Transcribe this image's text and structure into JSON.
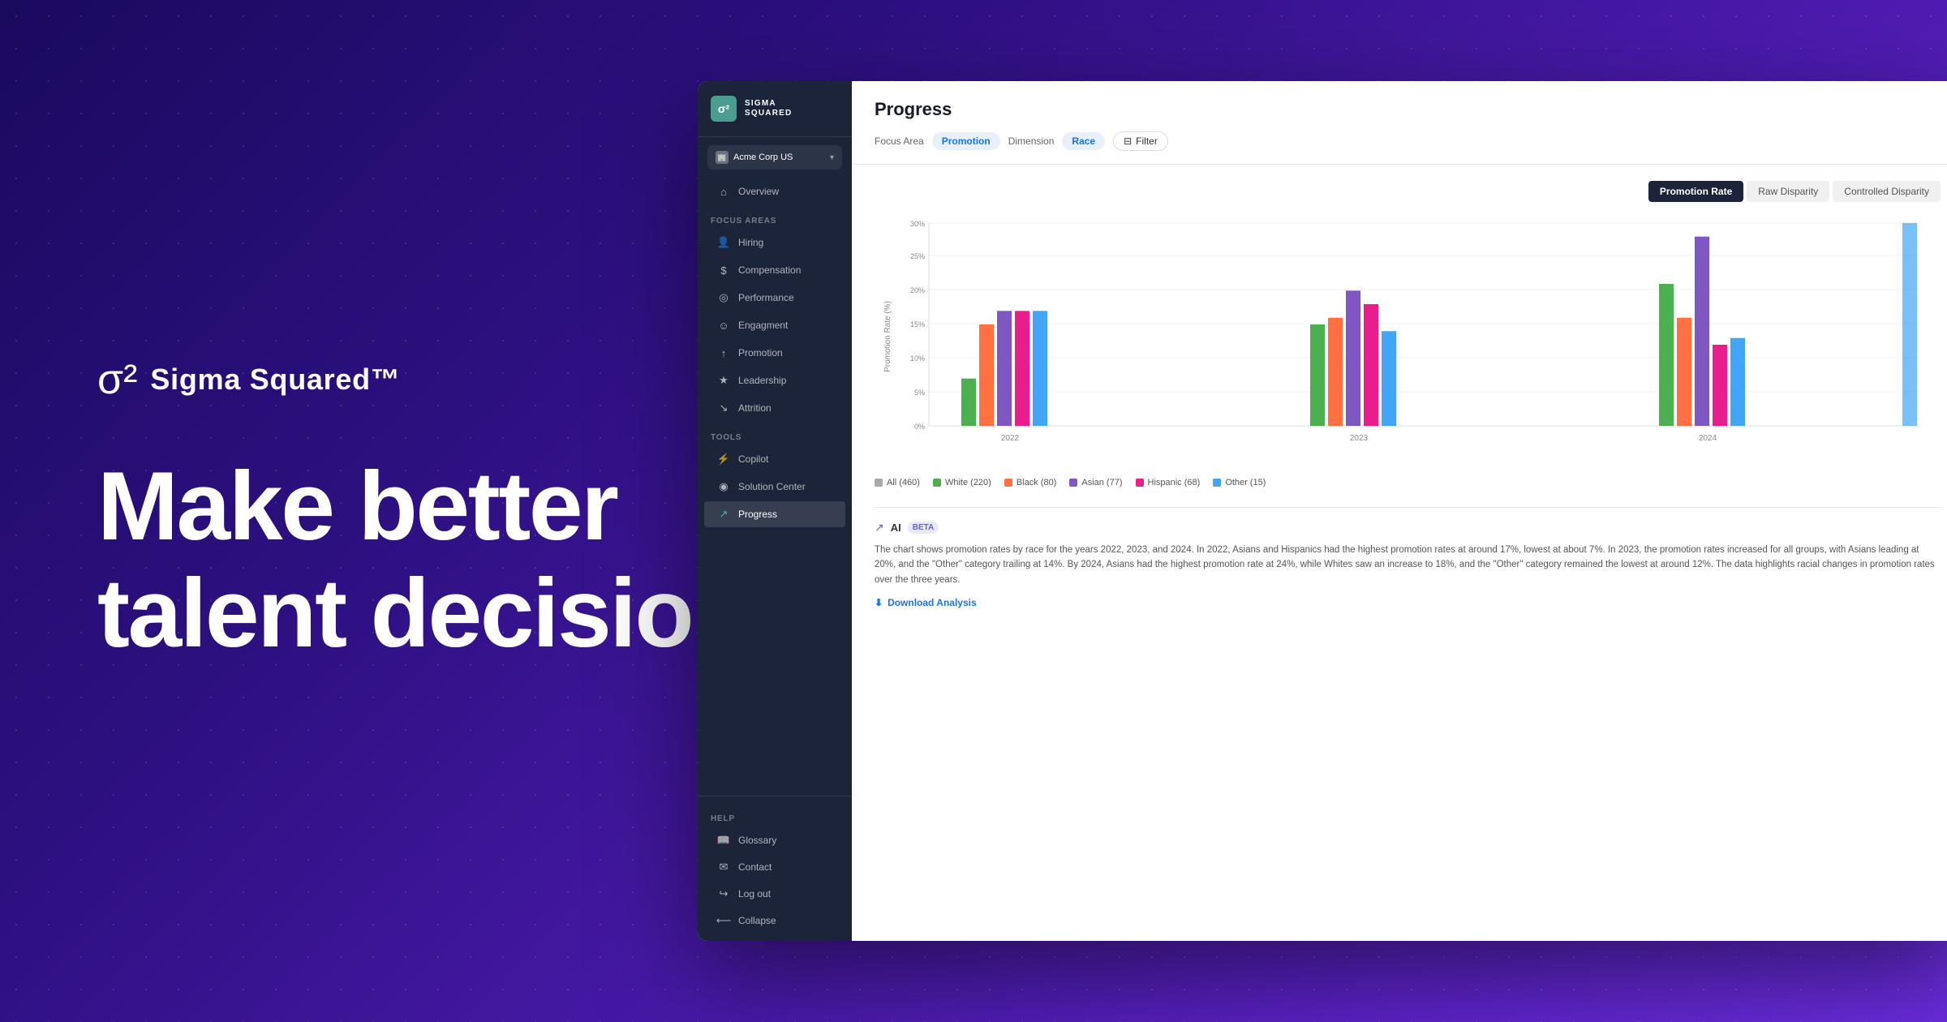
{
  "background": {
    "gradient_start": "#1a0a5e",
    "gradient_end": "#6b2de0"
  },
  "hero": {
    "brand_symbol": "σ²",
    "brand_name": "Sigma Squared™",
    "headline_line1": "Make better",
    "headline_line2": "talent decisions"
  },
  "app": {
    "logo_text": "SIGMA\nSQUARED",
    "logo_symbol": "σ²",
    "org_name": "Acme Corp US",
    "org_chevron": "▾",
    "nav_overview": "Overview",
    "focus_areas_label": "Focus Areas",
    "nav_hiring": "Hiring",
    "nav_compensation": "Compensation",
    "nav_performance": "Performance",
    "nav_engagement": "Engagment",
    "nav_promotion": "Promotion",
    "nav_leadership": "Leadership",
    "nav_attrition": "Attrition",
    "tools_label": "Tools",
    "nav_copilot": "Copilot",
    "nav_solution_center": "Solution Center",
    "nav_progress": "Progress",
    "help_label": "Help",
    "nav_glossary": "Glossary",
    "nav_contact": "Contact",
    "nav_logout": "Log out",
    "nav_collapse": "Collapse",
    "page_title": "Progress",
    "filter_focus_area_label": "Focus Area",
    "filter_focus_area_value": "Promotion",
    "filter_dimension_label": "Dimension",
    "filter_dimension_value": "Race",
    "filter_button": "Filter",
    "chart_tab_promotion_rate": "Promotion Rate",
    "chart_tab_raw_disparity": "Raw Disparity",
    "chart_tab_controlled_disparity": "Controlled Disparity",
    "chart_y_label": "Promotion Rate (%)",
    "chart_y_max": "30%",
    "chart_y_25": "25%",
    "chart_y_20": "20%",
    "chart_y_15": "15%",
    "chart_y_10": "10%",
    "chart_y_5": "5%",
    "chart_y_0": "0%",
    "chart_x_2022": "2022",
    "chart_x_2023": "2023",
    "chart_x_2024": "2024",
    "legend_all": "All (460)",
    "legend_white": "White (220)",
    "legend_black": "Black (80)",
    "legend_asian": "Asian (77)",
    "legend_hispanic": "Hispanic (68)",
    "legend_other": "Other (15)",
    "colors": {
      "white": "#4caf50",
      "black": "#ff7043",
      "asian": "#7e57c2",
      "hispanic": "#e91e8c",
      "other": "#42a5f5",
      "tall": "#26a69a"
    },
    "chart_data": {
      "2022": {
        "white": 7,
        "black": 15,
        "asian": 17,
        "hispanic": 17,
        "other": 17
      },
      "2023": {
        "white": 15,
        "black": 16,
        "asian": 20,
        "hispanic": 18,
        "other": 14
      },
      "2024": {
        "white": 21,
        "black": 16,
        "asian": 28,
        "hispanic": 12,
        "other": 13
      }
    },
    "ai_beta_label": "AI",
    "ai_beta_badge": "BETA",
    "ai_beta_text": "The chart shows promotion rates by race for the years 2022, 2023, and 2024. In 2022, Asians and Hispanics had the highest promotion rates at around 17%, lowest at about 7%. In 2023, the promotion rates increased for all groups, with Asians leading at 20%, and the \"Other\" category trailing at 14%. By 2024, Asians had the highest promotion rate at 24%, while Whites saw an increase to 18%, and the \"Other\" category remained the lowest at around 12%. The data highlights racial changes in promotion rates over the three years.",
    "download_link": "Download Analysis"
  }
}
